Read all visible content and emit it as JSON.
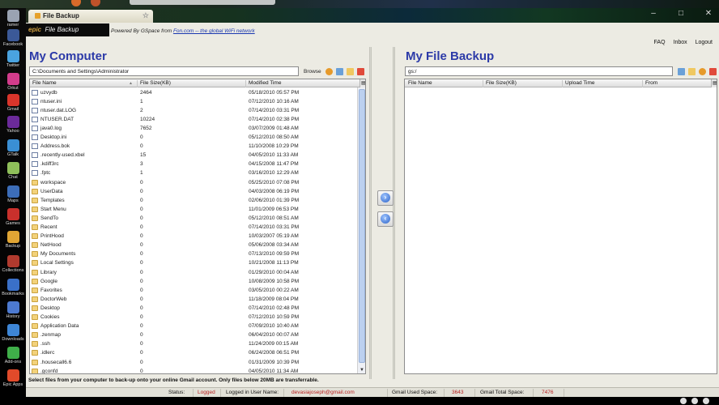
{
  "browser": {
    "tab_title": "File Backup"
  },
  "sidebar": {
    "items": [
      {
        "label": "ramer",
        "icon": "user-icon",
        "color": "#9aa3b2"
      },
      {
        "label": "Facebook",
        "icon": "facebook-icon",
        "color": "#3b5998"
      },
      {
        "label": "Twitter",
        "icon": "twitter-icon",
        "color": "#4aa3df"
      },
      {
        "label": "Orkut",
        "icon": "orkut-icon",
        "color": "#d23c8b"
      },
      {
        "label": "Gmail",
        "icon": "gmail-icon",
        "color": "#d9352b"
      },
      {
        "label": "Yahoo",
        "icon": "yahoo-icon",
        "color": "#6b2a9a"
      },
      {
        "label": "GTalk",
        "icon": "gtalk-icon",
        "color": "#3a8fd4"
      },
      {
        "label": "Chat",
        "icon": "chat-icon",
        "color": "#8fbf5a"
      },
      {
        "label": "Maps",
        "icon": "maps-icon",
        "color": "#3c6db8"
      },
      {
        "label": "Games",
        "icon": "games-icon",
        "color": "#c9302c"
      },
      {
        "label": "Backup",
        "icon": "backup-icon",
        "color": "#e0a534"
      },
      {
        "label": "Collections",
        "icon": "collections-icon",
        "color": "#b03a2e"
      },
      {
        "label": "Bookmarks",
        "icon": "bookmarks-icon",
        "color": "#3a70c8"
      },
      {
        "label": "History",
        "icon": "history-icon",
        "color": "#4d7ad0"
      },
      {
        "label": "Downloads",
        "icon": "downloads-icon",
        "color": "#3e86d6"
      },
      {
        "label": "Add-ons",
        "icon": "addons-icon",
        "color": "#3fae49"
      },
      {
        "label": "Epic Apps",
        "icon": "epic-apps-icon",
        "color": "#e14a2a"
      }
    ]
  },
  "header": {
    "logo_prefix": "epic",
    "logo_text": "File Backup",
    "powered_prefix": "Powered By GSpace from ",
    "powered_link": "Fon.com -- the global WiFi network",
    "links": [
      "FAQ",
      "Inbox",
      "Logout"
    ]
  },
  "left_panel": {
    "title": "My Computer",
    "path": "C:\\Documents and Settings\\Administrator",
    "browse_label": "Browse",
    "columns": [
      "File Name",
      "File Size(KB)",
      "Modified Time"
    ],
    "rows": [
      {
        "name": "uzvydb",
        "size": "2464",
        "time": "05/18/2010 05:57 PM",
        "type": "file"
      },
      {
        "name": "ntuser.ini",
        "size": "1",
        "time": "07/12/2010 10:16 AM",
        "type": "file"
      },
      {
        "name": "ntuser.dat.LOG",
        "size": "2",
        "time": "07/14/2010 03:31 PM",
        "type": "file"
      },
      {
        "name": "NTUSER.DAT",
        "size": "10224",
        "time": "07/14/2010 02:38 PM",
        "type": "file"
      },
      {
        "name": "java0.log",
        "size": "7652",
        "time": "03/07/2009 01:48 AM",
        "type": "file"
      },
      {
        "name": "Desktop.ini",
        "size": "0",
        "time": "05/12/2010 08:50 AM",
        "type": "file"
      },
      {
        "name": "Address.bok",
        "size": "0",
        "time": "11/10/2008 10:29 PM",
        "type": "file"
      },
      {
        "name": ".recently-used.xbel",
        "size": "15",
        "time": "04/05/2010 11:33 AM",
        "type": "file"
      },
      {
        "name": ".kdiff3rc",
        "size": "3",
        "time": "04/15/2008 11:47 PM",
        "type": "file"
      },
      {
        "name": ".fptc",
        "size": "1",
        "time": "03/16/2010 12:29 AM",
        "type": "file"
      },
      {
        "name": "workspace",
        "size": "0",
        "time": "05/25/2010 07:08 PM",
        "type": "folder"
      },
      {
        "name": "UserData",
        "size": "0",
        "time": "04/03/2008 06:19 PM",
        "type": "folder"
      },
      {
        "name": "Templates",
        "size": "0",
        "time": "02/06/2010 01:39 PM",
        "type": "folder"
      },
      {
        "name": "Start Menu",
        "size": "0",
        "time": "11/01/2009 06:53 PM",
        "type": "folder"
      },
      {
        "name": "SendTo",
        "size": "0",
        "time": "05/12/2010 08:51 AM",
        "type": "folder"
      },
      {
        "name": "Recent",
        "size": "0",
        "time": "07/14/2010 03:31 PM",
        "type": "folder"
      },
      {
        "name": "PrintHood",
        "size": "0",
        "time": "10/03/2007 05:19 AM",
        "type": "folder"
      },
      {
        "name": "NetHood",
        "size": "0",
        "time": "05/06/2008 03:34 AM",
        "type": "folder"
      },
      {
        "name": "My Documents",
        "size": "0",
        "time": "07/13/2010 09:59 PM",
        "type": "folder"
      },
      {
        "name": "Local Settings",
        "size": "0",
        "time": "10/21/2008 11:13 PM",
        "type": "folder"
      },
      {
        "name": "Library",
        "size": "0",
        "time": "01/29/2010 00:04 AM",
        "type": "folder"
      },
      {
        "name": "Google",
        "size": "0",
        "time": "10/08/2009 10:58 PM",
        "type": "folder"
      },
      {
        "name": "Favorites",
        "size": "0",
        "time": "03/05/2010 00:22 AM",
        "type": "folder"
      },
      {
        "name": "DoctorWeb",
        "size": "0",
        "time": "11/18/2009 08:04 PM",
        "type": "folder"
      },
      {
        "name": "Desktop",
        "size": "0",
        "time": "07/14/2010 02:48 PM",
        "type": "folder"
      },
      {
        "name": "Cookies",
        "size": "0",
        "time": "07/12/2010 10:59 PM",
        "type": "folder"
      },
      {
        "name": "Application Data",
        "size": "0",
        "time": "07/09/2010 10:40 AM",
        "type": "folder"
      },
      {
        "name": ".zenmap",
        "size": "0",
        "time": "06/04/2010 00:07 AM",
        "type": "folder"
      },
      {
        "name": ".ssh",
        "size": "0",
        "time": "11/24/2009 00:15 AM",
        "type": "folder"
      },
      {
        "name": ".idlerc",
        "size": "0",
        "time": "06/24/2008 06:51 PM",
        "type": "folder"
      },
      {
        "name": ".housecall6.6",
        "size": "0",
        "time": "01/31/2009 10:39 PM",
        "type": "folder"
      },
      {
        "name": ".gconfd",
        "size": "0",
        "time": "04/05/2010 11:34 AM",
        "type": "folder"
      }
    ]
  },
  "right_panel": {
    "title": "My File Backup",
    "path": "gs:/",
    "columns": [
      "File Name",
      "File Size(KB)",
      "Upload Time",
      "From"
    ]
  },
  "transfer": {
    "upload_icon": "arrow-right-icon",
    "download_icon": "arrow-left-icon"
  },
  "note": "Select files from your computer to back-up onto your online Gmail account.   Only files below 20MB are transferrable.",
  "status": {
    "status_label": "Status:",
    "status_value": "Logged",
    "user_label": "Logged in User Name:",
    "user_value": "devasiajoseph@gmail.com",
    "used_label": "Gmail Used Space:",
    "used_value": "3643",
    "total_label": "Gmail Total Space:",
    "total_value": "7476"
  },
  "colors": {
    "title": "#2c3aa8",
    "status_value": "#b82020"
  }
}
